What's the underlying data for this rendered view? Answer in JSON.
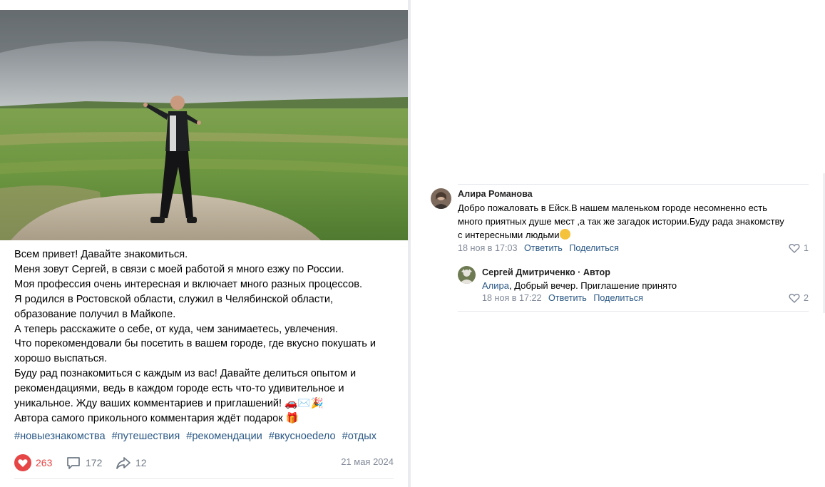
{
  "post": {
    "text_lines": [
      "Всем привет! Давайте знакомиться.",
      "Меня зовут Сергей, в связи с моей работой я много езжу по России.",
      "Моя профессия очень интересная и включает много разных процессов.",
      "Я родился в Ростовской области, служил в Челябинской области,",
      "образование получил в Майкопе.",
      "А теперь расскажите о себе, от куда, чем занимаетесь, увлечения.",
      "Что порекомендовали бы посетить в вашем городе, где вкусно покушать и",
      "хорошо выспаться.",
      "Буду рад познакомиться с каждым из вас! Давайте делиться опытом и",
      "рекомендациями, ведь в каждом городе есть что-то удивительное и",
      "уникальное. Жду ваших комментариев и приглашений! 🚗✉️🎉",
      "Автора самого прикольного комментария ждёт подарок 🎁"
    ],
    "hashtags": [
      "#новыезнакомства",
      "#путешествия",
      "#рекомендации",
      "#вкусноеdело",
      "#отдых"
    ],
    "likes": "263",
    "comments": "172",
    "shares": "12",
    "date": "21 мая 2024",
    "colors": {
      "like": "#e64646",
      "link": "#2a5885",
      "meta": "#828a99"
    },
    "icons": {
      "like": "heart-filled-icon",
      "comment": "speech-bubble-icon",
      "share": "share-arrow-icon"
    }
  },
  "comments": [
    {
      "author": "Алира Романова",
      "text_lines": [
        "Добро пожаловать в Ейск.В нашем маленьком городе несомненно есть",
        "много приятных душе мест ,а так же загадок истории.Буду рада знакомству",
        "с интересными людьми"
      ],
      "time": "18 ноя в 17:03",
      "reply_label": "Ответить",
      "share_label": "Поделиться",
      "likes": "1"
    },
    {
      "author": "Сергей Дмитриченко · Автор",
      "mention": "Алира",
      "text": ", Добрый вечер. Приглашение принято",
      "time": "18 ноя в 17:22",
      "reply_label": "Ответить",
      "share_label": "Поделиться",
      "likes": "2"
    }
  ]
}
